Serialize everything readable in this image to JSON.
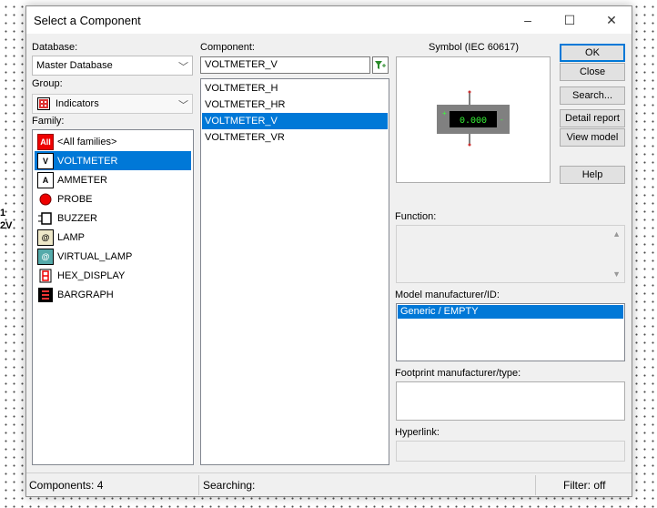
{
  "background": {
    "label_line1": "1",
    "label_line2": "2V"
  },
  "window": {
    "title": "Select a Component",
    "minimize": "–",
    "maximize": "☐",
    "close": "✕"
  },
  "database": {
    "label": "Database:",
    "value": "Master Database"
  },
  "group": {
    "label": "Group:",
    "value": "Indicators"
  },
  "family": {
    "label": "Family:",
    "items": [
      {
        "label": "<All families>",
        "icon": "all-families-icon",
        "icon_text": "All"
      },
      {
        "label": "VOLTMETER",
        "icon": "voltmeter-icon",
        "icon_text": "V"
      },
      {
        "label": "AMMETER",
        "icon": "ammeter-icon",
        "icon_text": "A"
      },
      {
        "label": "PROBE",
        "icon": "probe-icon",
        "icon_text": ""
      },
      {
        "label": "BUZZER",
        "icon": "buzzer-icon",
        "icon_text": ""
      },
      {
        "label": "LAMP",
        "icon": "lamp-icon",
        "icon_text": "@"
      },
      {
        "label": "VIRTUAL_LAMP",
        "icon": "virtual-lamp-icon",
        "icon_text": "@"
      },
      {
        "label": "HEX_DISPLAY",
        "icon": "hex-display-icon",
        "icon_text": ""
      },
      {
        "label": "BARGRAPH",
        "icon": "bargraph-icon",
        "icon_text": ""
      }
    ],
    "selected": "VOLTMETER"
  },
  "component": {
    "label": "Component:",
    "value": "VOLTMETER_V",
    "items": [
      "VOLTMETER_H",
      "VOLTMETER_HR",
      "VOLTMETER_V",
      "VOLTMETER_VR"
    ],
    "selected": "VOLTMETER_V"
  },
  "symbol": {
    "label": "Symbol (IEC 60617)",
    "display_value": "0.000",
    "plus": "+",
    "minus": "-"
  },
  "buttons": {
    "ok": "OK",
    "close": "Close",
    "search": "Search...",
    "detail_report": "Detail report",
    "view_model": "View model",
    "help": "Help"
  },
  "function": {
    "label": "Function:"
  },
  "model": {
    "label": "Model manufacturer/ID:",
    "items": [
      "Generic / EMPTY"
    ],
    "selected": "Generic / EMPTY"
  },
  "footprint": {
    "label": "Footprint manufacturer/type:"
  },
  "hyperlink": {
    "label": "Hyperlink:"
  },
  "status": {
    "components": "Components: 4",
    "searching": "Searching:",
    "filter": "Filter: off"
  },
  "colors": {
    "accent": "#0078d7",
    "display_bg": "#000000",
    "display_text": "#39ff39",
    "meter_body": "#808080"
  }
}
